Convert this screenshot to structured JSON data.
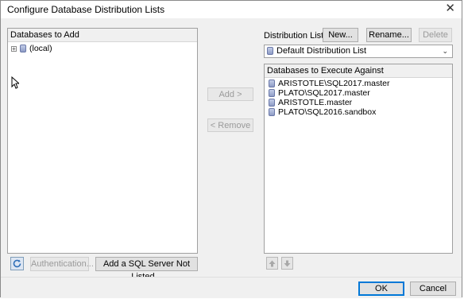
{
  "window": {
    "title": "Configure Database Distribution Lists",
    "close_glyph": "✕"
  },
  "left_panel": {
    "header": "Databases to Add",
    "tree": [
      {
        "label": "(local)",
        "expander": "+",
        "icon": "database-icon"
      }
    ]
  },
  "center": {
    "add_label": "Add >",
    "remove_label": "< Remove"
  },
  "right": {
    "distribution_list_label": "Distribution List:",
    "new_label": "New...",
    "rename_label": "Rename...",
    "delete_label": "Delete",
    "selected_list": "Default Distribution List",
    "panel_header": "Databases to Execute Against",
    "items": [
      "ARISTOTLE\\SQL2017.master",
      "PLATO\\SQL2017.master",
      "ARISTOTLE.master",
      "PLATO\\SQL2016.sandbox"
    ]
  },
  "bottom_left": {
    "refresh_icon": "refresh-icon",
    "authentication_label": "Authentication...",
    "add_server_label": "Add a SQL Server Not Listed..."
  },
  "bottom_right": {
    "move_up_icon": "arrow-up-icon",
    "move_down_icon": "arrow-down-icon"
  },
  "footer": {
    "ok_label": "OK",
    "cancel_label": "Cancel"
  },
  "colors": {
    "dialog_bg": "#f0f0f0",
    "panel_bg": "#ffffff",
    "accent": "#0078d7"
  }
}
